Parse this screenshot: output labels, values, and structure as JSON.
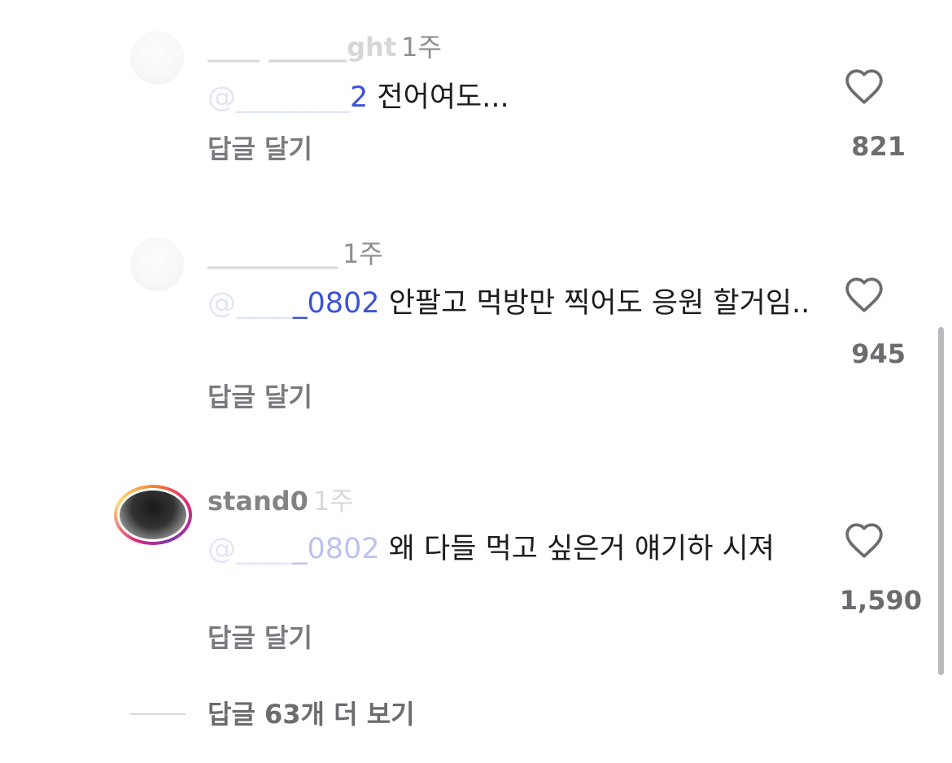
{
  "comments": [
    {
      "username": "____ ______ght",
      "time": "1주",
      "mention_hidden": "@________",
      "mention_visible": "2",
      "text": "전어여도...",
      "reply_label": "답글 달기",
      "like_count": "821",
      "heart_icon": "heart-outline-icon"
    },
    {
      "username": "__________",
      "time": "1주",
      "mention_hidden": "@____",
      "mention_visible": "_0802",
      "text": "안팔고 먹방만 찍어도 응원 할거임..",
      "reply_label": "답글 달기",
      "like_count": "945",
      "heart_icon": "heart-outline-icon"
    },
    {
      "username": "stand0",
      "time": "1주",
      "mention_hidden": "@____",
      "mention_visible": "_0802",
      "text": "왜 다들 먹고 싶은거 얘기하 시져",
      "reply_label": "답글 달기",
      "like_count": "1,590",
      "heart_icon": "heart-outline-icon"
    }
  ],
  "more_replies": {
    "label": "답글 63개 더 보기"
  },
  "colors": {
    "mention": "#3b51d8",
    "secondary_text": "#7a7a80",
    "like_count": "#6b6b70"
  }
}
